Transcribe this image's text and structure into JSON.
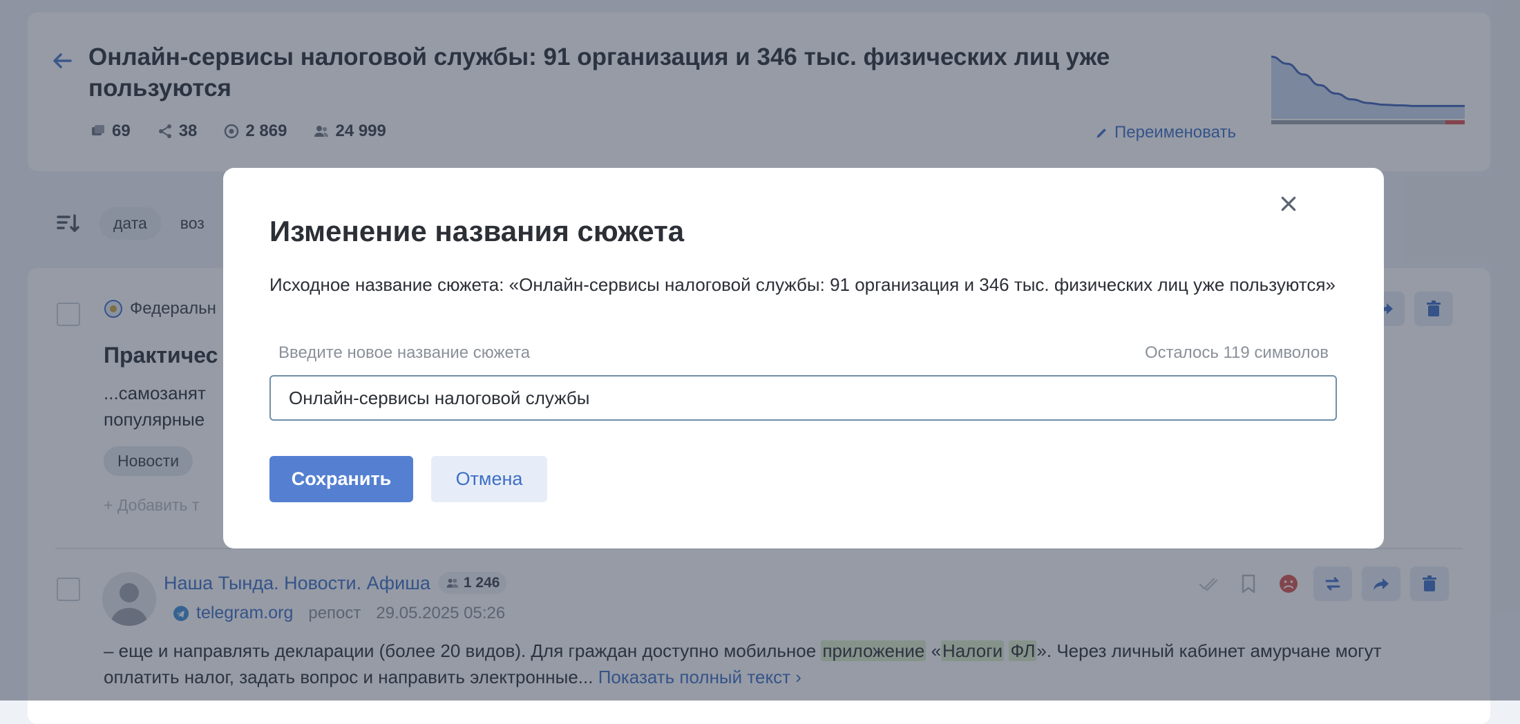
{
  "story": {
    "title": "Онлайн-сервисы налоговой службы: 91 организация и 346 тыс. физических лиц уже пользуются",
    "stats": {
      "messages": "69",
      "reposts": "38",
      "views": "2 869",
      "audience": "24 999"
    },
    "rename_label": "Переименовать"
  },
  "sortbar": {
    "chip_date": "дата",
    "chip_partial": "воз"
  },
  "feed": {
    "item1": {
      "source_partial": "Федеральн",
      "title_partial": "Практичес",
      "text_line1_partial": "...самозанят",
      "text_line2_partial": "популярные",
      "tag": "Новости",
      "add_tag_partial": "+ Добавить т"
    },
    "item2": {
      "source_name": "Наша Тында. Новости. Афиша",
      "audience": "1 246",
      "domain": "telegram.org",
      "type": "репост",
      "date": "29.05.2025 05:26",
      "text_part1": "– еще и направлять декларации (более 20 видов). Для граждан доступно мобильное ",
      "hl1": "приложение",
      "text_part2": " «",
      "hl2": "Налоги",
      "text_part3": " ",
      "hl3": "ФЛ",
      "text_part4": "». Через личный кабинет амурчане могут оплатить налог, задать вопрос и направить электронные... ",
      "show_more": "Показать полный текст ›"
    }
  },
  "modal": {
    "title": "Изменение названия сюжета",
    "original_label": "Исходное название сюжета: «Онлайн-сервисы налоговой службы: 91 организация и 346 тыс. физических лиц уже пользуются»",
    "field_placeholder_label": "Введите новое название сюжета",
    "remaining": "Осталось 119 символов",
    "input_value": "Онлайн-сервисы налоговой службы",
    "save_label": "Сохранить",
    "cancel_label": "Отмена"
  },
  "colors": {
    "accent": "#5580d1",
    "link": "#3d6fc6",
    "highlight": "#dfeeca",
    "negative": "#d9534f"
  },
  "sparkline": {
    "values": [
      100,
      88,
      70,
      52,
      38,
      28,
      22,
      19,
      18,
      17,
      17,
      17,
      17
    ]
  }
}
